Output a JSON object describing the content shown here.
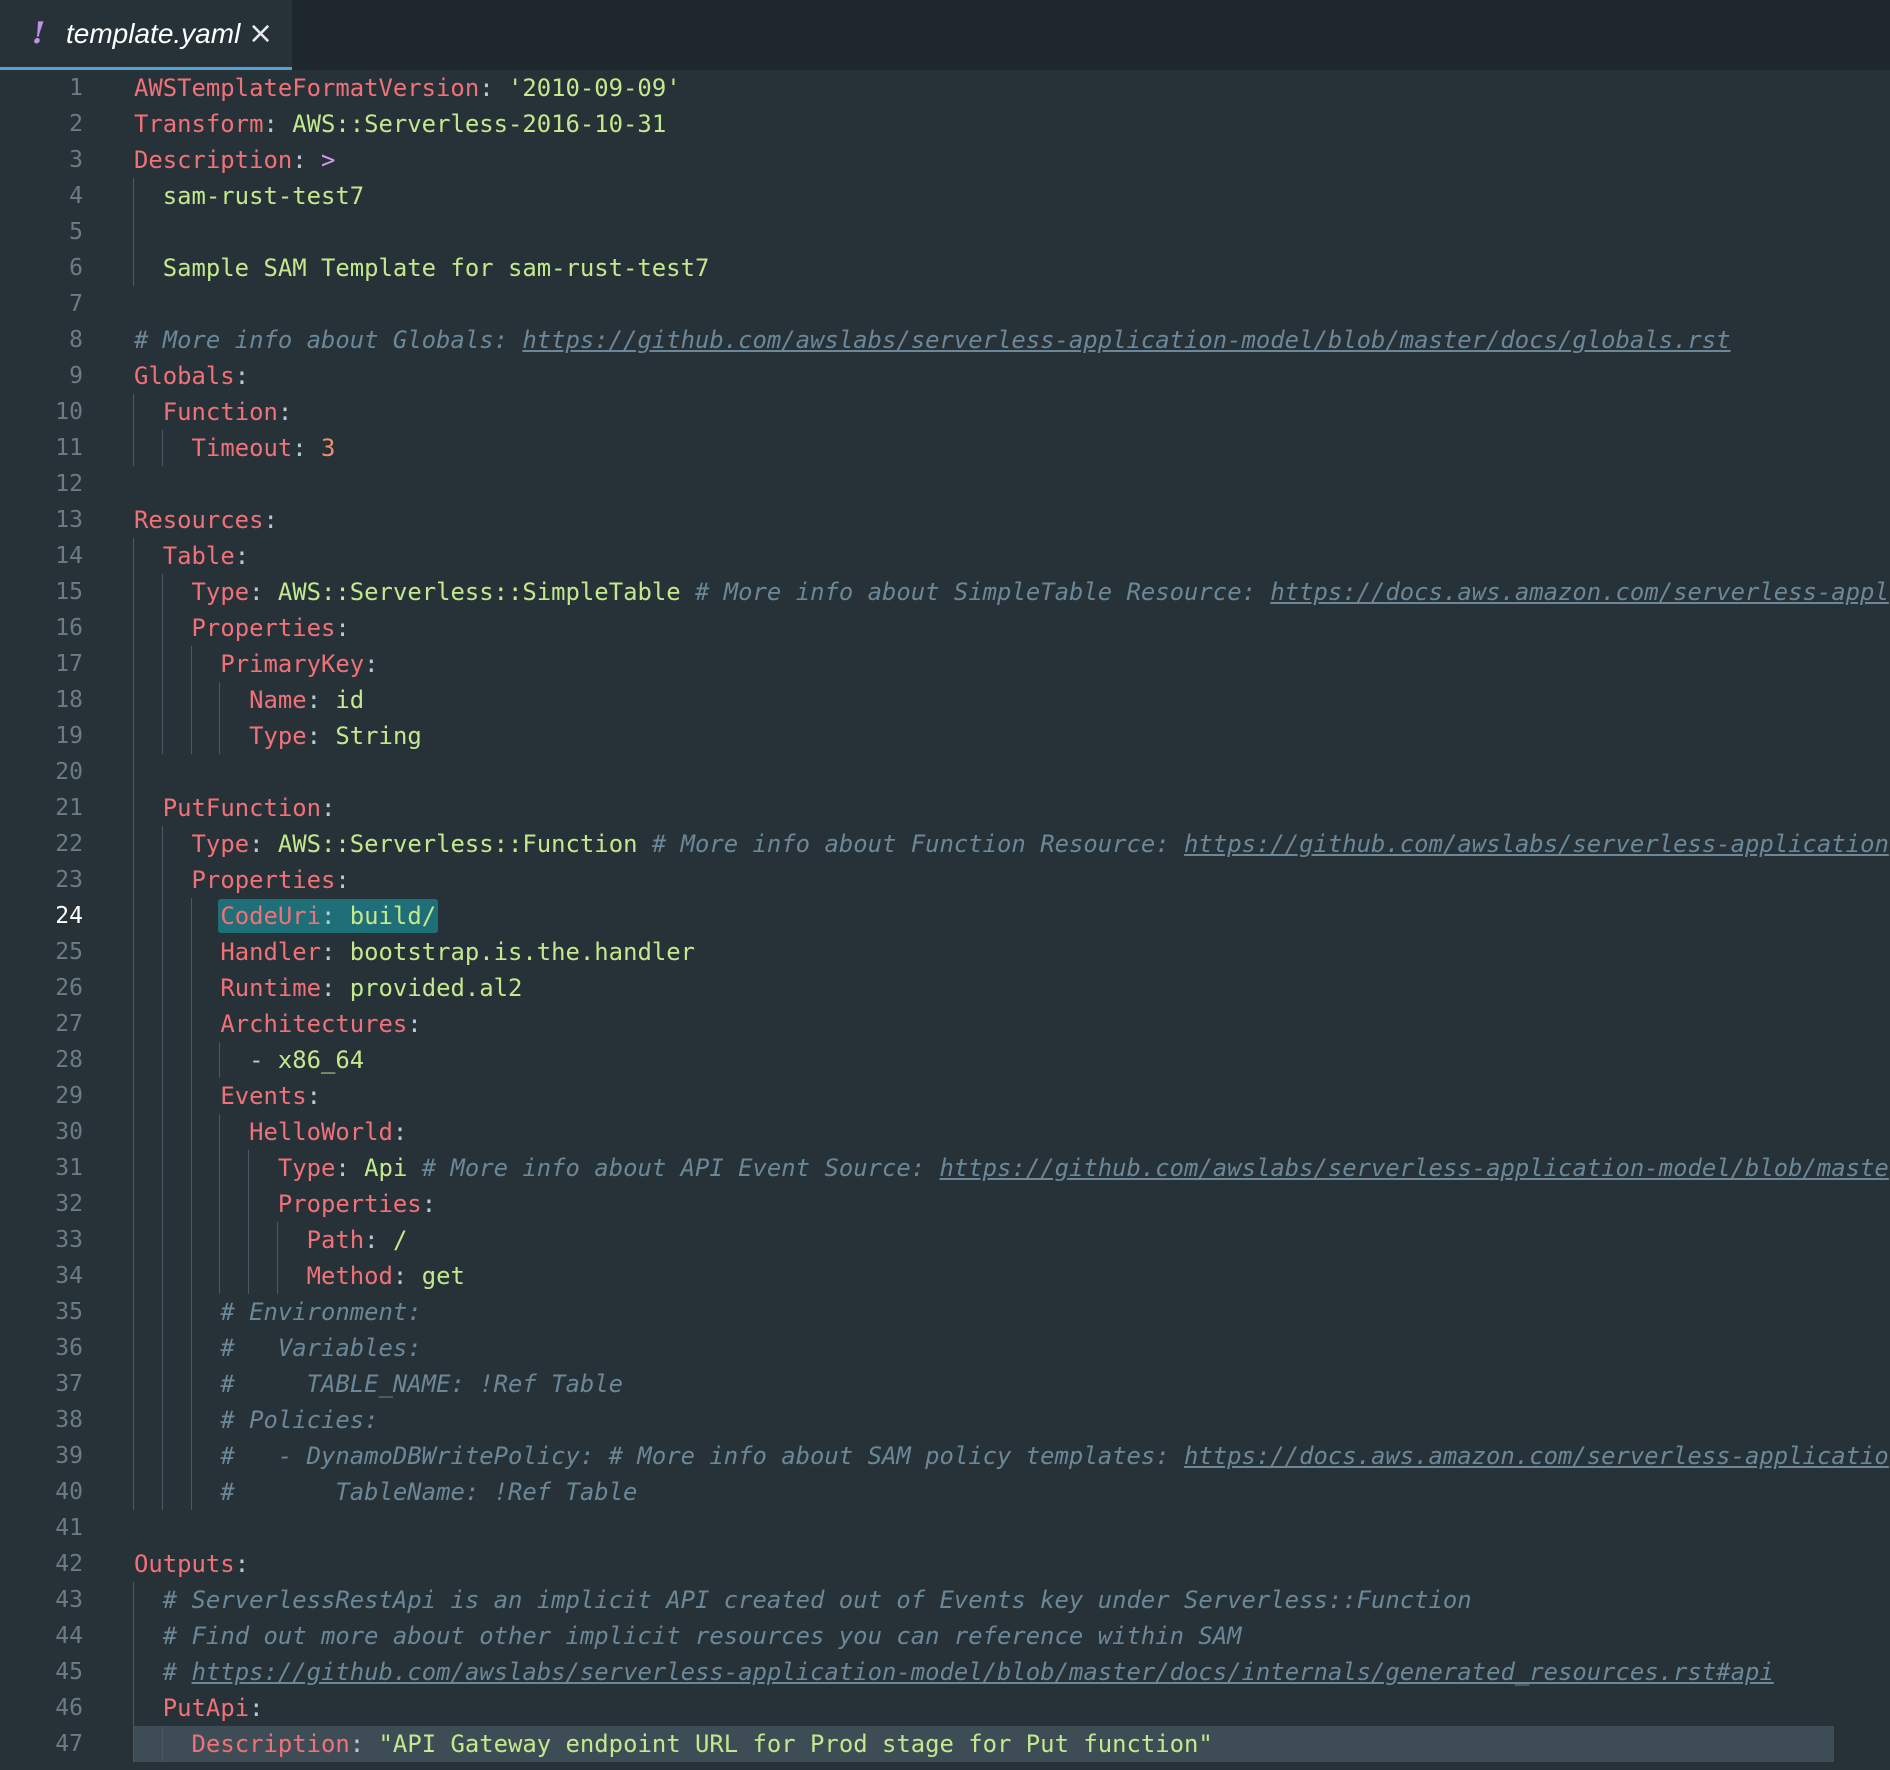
{
  "tab": {
    "warning_glyph": "!",
    "title": "template.yaml",
    "close_glyph": "×",
    "icon": "yaml-warning-icon"
  },
  "editor": {
    "active_line": 24,
    "lines": [
      [
        [
          "k",
          "AWSTemplateFormatVersion"
        ],
        [
          "c",
          ": "
        ],
        [
          "s",
          "'2010-09-09'"
        ]
      ],
      [
        [
          "k",
          "Transform"
        ],
        [
          "c",
          ": "
        ],
        [
          "s",
          "AWS::Serverless-2016-10-31"
        ]
      ],
      [
        [
          "k",
          "Description"
        ],
        [
          "c",
          ": "
        ],
        [
          "o",
          ">"
        ]
      ],
      [
        [
          "s",
          "  sam-rust-test7"
        ]
      ],
      [],
      [
        [
          "s",
          "  Sample SAM Template for sam-rust-test7"
        ]
      ],
      [],
      [
        [
          "cm",
          "# More info about Globals: "
        ],
        [
          "u",
          "https://github.com/awslabs/serverless-application-model/blob/master/docs/globals.rst"
        ]
      ],
      [
        [
          "k",
          "Globals"
        ],
        [
          "c",
          ":"
        ]
      ],
      [
        [
          "s",
          "  "
        ],
        [
          "k",
          "Function"
        ],
        [
          "c",
          ":"
        ]
      ],
      [
        [
          "s",
          "    "
        ],
        [
          "k",
          "Timeout"
        ],
        [
          "c",
          ": "
        ],
        [
          "n",
          "3"
        ]
      ],
      [],
      [
        [
          "k",
          "Resources"
        ],
        [
          "c",
          ":"
        ]
      ],
      [
        [
          "s",
          "  "
        ],
        [
          "k",
          "Table"
        ],
        [
          "c",
          ":"
        ]
      ],
      [
        [
          "s",
          "    "
        ],
        [
          "k",
          "Type"
        ],
        [
          "c",
          ": "
        ],
        [
          "s",
          "AWS::Serverless::SimpleTable"
        ],
        [
          "cm",
          " # More info about SimpleTable Resource: "
        ],
        [
          "u",
          "https://docs.aws.amazon.com/serverless-appl"
        ]
      ],
      [
        [
          "s",
          "    "
        ],
        [
          "k",
          "Properties"
        ],
        [
          "c",
          ":"
        ]
      ],
      [
        [
          "s",
          "      "
        ],
        [
          "k",
          "PrimaryKey"
        ],
        [
          "c",
          ":"
        ]
      ],
      [
        [
          "s",
          "        "
        ],
        [
          "k",
          "Name"
        ],
        [
          "c",
          ": "
        ],
        [
          "s",
          "id"
        ]
      ],
      [
        [
          "s",
          "        "
        ],
        [
          "k",
          "Type"
        ],
        [
          "c",
          ": "
        ],
        [
          "s",
          "String"
        ]
      ],
      [],
      [
        [
          "s",
          "  "
        ],
        [
          "k",
          "PutFunction"
        ],
        [
          "c",
          ":"
        ]
      ],
      [
        [
          "s",
          "    "
        ],
        [
          "k",
          "Type"
        ],
        [
          "c",
          ": "
        ],
        [
          "s",
          "AWS::Serverless::Function"
        ],
        [
          "cm",
          " # More info about Function Resource: "
        ],
        [
          "u",
          "https://github.com/awslabs/serverless-application"
        ]
      ],
      [
        [
          "s",
          "    "
        ],
        [
          "k",
          "Properties"
        ],
        [
          "c",
          ":"
        ]
      ],
      [
        [
          "s",
          "      "
        ],
        [
          "k",
          "CodeUri"
        ],
        [
          "c",
          ": "
        ],
        [
          "s",
          "build/"
        ]
      ],
      [
        [
          "s",
          "      "
        ],
        [
          "k",
          "Handler"
        ],
        [
          "c",
          ": "
        ],
        [
          "s",
          "bootstrap.is.the.handler"
        ]
      ],
      [
        [
          "s",
          "      "
        ],
        [
          "k",
          "Runtime"
        ],
        [
          "c",
          ": "
        ],
        [
          "s",
          "provided.al2"
        ]
      ],
      [
        [
          "s",
          "      "
        ],
        [
          "k",
          "Architectures"
        ],
        [
          "c",
          ":"
        ]
      ],
      [
        [
          "s",
          "        "
        ],
        [
          "c",
          "- "
        ],
        [
          "s",
          "x86_64"
        ]
      ],
      [
        [
          "s",
          "      "
        ],
        [
          "k",
          "Events"
        ],
        [
          "c",
          ":"
        ]
      ],
      [
        [
          "s",
          "        "
        ],
        [
          "k",
          "HelloWorld"
        ],
        [
          "c",
          ":"
        ]
      ],
      [
        [
          "s",
          "          "
        ],
        [
          "k",
          "Type"
        ],
        [
          "c",
          ": "
        ],
        [
          "s",
          "Api"
        ],
        [
          "cm",
          " # More info about API Event Source: "
        ],
        [
          "u",
          "https://github.com/awslabs/serverless-application-model/blob/maste"
        ]
      ],
      [
        [
          "s",
          "          "
        ],
        [
          "k",
          "Properties"
        ],
        [
          "c",
          ":"
        ]
      ],
      [
        [
          "s",
          "            "
        ],
        [
          "k",
          "Path"
        ],
        [
          "c",
          ": "
        ],
        [
          "s",
          "/"
        ]
      ],
      [
        [
          "s",
          "            "
        ],
        [
          "k",
          "Method"
        ],
        [
          "c",
          ": "
        ],
        [
          "s",
          "get"
        ]
      ],
      [
        [
          "s",
          "      "
        ],
        [
          "cm",
          "# Environment:"
        ]
      ],
      [
        [
          "s",
          "      "
        ],
        [
          "cm",
          "#   Variables:"
        ]
      ],
      [
        [
          "s",
          "      "
        ],
        [
          "cm",
          "#     TABLE_NAME: !Ref Table"
        ]
      ],
      [
        [
          "s",
          "      "
        ],
        [
          "cm",
          "# Policies:"
        ]
      ],
      [
        [
          "s",
          "      "
        ],
        [
          "cm",
          "#   - DynamoDBWritePolicy: # More info about SAM policy templates: "
        ],
        [
          "u",
          "https://docs.aws.amazon.com/serverless-applicatio"
        ]
      ],
      [
        [
          "s",
          "      "
        ],
        [
          "cm",
          "#       TableName: !Ref Table"
        ]
      ],
      [],
      [
        [
          "k",
          "Outputs"
        ],
        [
          "c",
          ":"
        ]
      ],
      [
        [
          "s",
          "  "
        ],
        [
          "cm",
          "# ServerlessRestApi is an implicit API created out of Events key under Serverless::Function"
        ]
      ],
      [
        [
          "s",
          "  "
        ],
        [
          "cm",
          "# Find out more about other implicit resources you can reference within SAM"
        ]
      ],
      [
        [
          "s",
          "  "
        ],
        [
          "cm",
          "# "
        ],
        [
          "u",
          "https://github.com/awslabs/serverless-application-model/blob/master/docs/internals/generated_resources.rst#api"
        ]
      ],
      [
        [
          "s",
          "  "
        ],
        [
          "k",
          "PutApi"
        ],
        [
          "c",
          ":"
        ]
      ],
      [
        [
          "s",
          "    "
        ],
        [
          "k",
          "Description"
        ],
        [
          "c",
          ": "
        ],
        [
          "s",
          "\"API Gateway endpoint URL for Prod stage for Put function\""
        ]
      ]
    ]
  }
}
